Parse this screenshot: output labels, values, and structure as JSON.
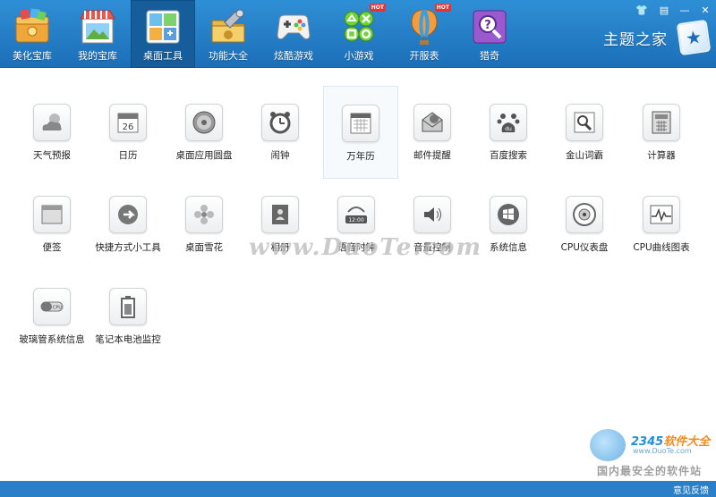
{
  "nav": {
    "tabs": [
      {
        "label": "美化宝库",
        "icon": "beautify-icon"
      },
      {
        "label": "我的宝库",
        "icon": "store-icon"
      },
      {
        "label": "桌面工具",
        "icon": "desktop-tools-icon",
        "active": true
      },
      {
        "label": "功能大全",
        "icon": "toolbox-icon"
      },
      {
        "label": "炫酷游戏",
        "icon": "gamepad-icon"
      },
      {
        "label": "小游戏",
        "icon": "mini-game-icon",
        "badge": "HOT"
      },
      {
        "label": "开服表",
        "icon": "balloon-icon",
        "badge": "HOT"
      },
      {
        "label": "猎奇",
        "icon": "curiosity-icon"
      }
    ]
  },
  "brand": {
    "title": "主题之家"
  },
  "tools": [
    {
      "label": "天气预报",
      "icon": "weather-icon"
    },
    {
      "label": "日历",
      "icon": "calendar-icon",
      "text": "26"
    },
    {
      "label": "桌面应用圆盘",
      "icon": "disc-icon"
    },
    {
      "label": "闹钟",
      "icon": "alarm-clock-icon"
    },
    {
      "label": "万年历",
      "icon": "perpetual-calendar-icon"
    },
    {
      "label": "邮件提醒",
      "icon": "mail-icon"
    },
    {
      "label": "百度搜索",
      "icon": "baidu-icon",
      "text": "du"
    },
    {
      "label": "金山词霸",
      "icon": "dictionary-icon"
    },
    {
      "label": "计算器",
      "icon": "calculator-icon"
    },
    {
      "label": "便签",
      "icon": "sticky-note-icon"
    },
    {
      "label": "快捷方式小工具",
      "icon": "shortcut-icon"
    },
    {
      "label": "桌面雪花",
      "icon": "snowflake-icon"
    },
    {
      "label": "相册",
      "icon": "album-icon"
    },
    {
      "label": "语音时钟",
      "icon": "voice-clock-icon",
      "text": "12:00"
    },
    {
      "label": "音量控制",
      "icon": "volume-icon"
    },
    {
      "label": "系统信息",
      "icon": "windows-icon"
    },
    {
      "label": "CPU仪表盘",
      "icon": "gauge-icon"
    },
    {
      "label": "CPU曲线图表",
      "icon": "cpu-graph-icon"
    },
    {
      "label": "玻璃管系统信息",
      "icon": "glass-tube-icon",
      "text": "CPU"
    },
    {
      "label": "笔记本电池监控",
      "icon": "battery-icon"
    }
  ],
  "watermark": {
    "center": "www.DuoTe.com",
    "logo_num": "2345",
    "logo_text": "软件大全",
    "logo_url": "www.DuoTe.com",
    "slogan": "国内最安全的软件站"
  },
  "footer": {
    "feedback": "意见反馈"
  },
  "colors": {
    "bar": "#2a7fc9",
    "active_tab": "#165d9c",
    "hot": "#e23434"
  }
}
